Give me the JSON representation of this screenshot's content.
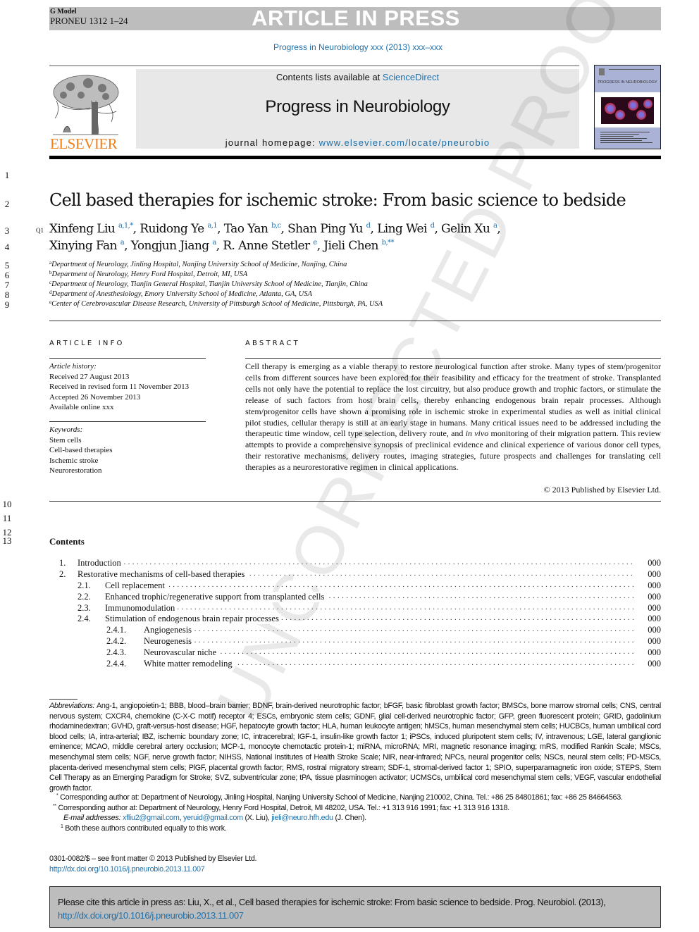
{
  "header": {
    "model": "G Model",
    "manuscript": "PRONEU 1312 1–24",
    "banner": "ARTICLE IN PRESS",
    "journal_ref": "Progress in Neurobiology xxx (2013) xxx–xxx"
  },
  "masthead": {
    "publisher": "ELSEVIER",
    "contents_prefix": "Contents lists available at ",
    "contents_link": "ScienceDirect",
    "journal_name": "Progress in Neurobiology",
    "homepage_prefix": "journal homepage: ",
    "homepage_link": "www.elsevier.com/locate/pneurobio",
    "cover_title": "PROGRESS IN NEUROBIOLOGY",
    "brand_color": "#f07f1b",
    "link_color": "#1f6fa8"
  },
  "line_numbers": [
    "1",
    "2",
    "3",
    "4",
    "5",
    "6",
    "7",
    "8",
    "9",
    "10",
    "11",
    "12",
    "13"
  ],
  "query_marker": "Q1",
  "article": {
    "title": "Cell based therapies for ischemic stroke: From basic science to bedside",
    "authors": [
      {
        "name": "Xinfeng Liu",
        "sup": "a,1,*",
        "sep": ", "
      },
      {
        "name": "Ruidong Ye",
        "sup": "a,1",
        "sep": ", "
      },
      {
        "name": "Tao Yan",
        "sup": "b,c",
        "sep": ", "
      },
      {
        "name": "Shan Ping Yu",
        "sup": "d",
        "sep": ", "
      },
      {
        "name": "Ling Wei",
        "sup": "d",
        "sep": ", "
      },
      {
        "name": "Gelin Xu",
        "sup": "a",
        "sep": ","
      },
      {
        "name": "Xinying Fan",
        "sup": "a",
        "sep": ", "
      },
      {
        "name": "Yongjun Jiang",
        "sup": "a",
        "sep": ", "
      },
      {
        "name": "R. Anne Stetler",
        "sup": "e",
        "sep": ", "
      },
      {
        "name": "Jieli Chen",
        "sup": "b,**",
        "sep": ""
      }
    ],
    "affiliations": [
      {
        "key": "a",
        "text": "Department of Neurology, Jinling Hospital, Nanjing University School of Medicine, Nanjing, China"
      },
      {
        "key": "b",
        "text": "Department of Neurology, Henry Ford Hospital, Detroit, MI, USA"
      },
      {
        "key": "c",
        "text": "Department of Neurology, Tianjin General Hospital, Tianjin University School of Medicine, Tianjin, China"
      },
      {
        "key": "d",
        "text": "Department of Anesthesiology, Emory University School of Medicine, Atlanta, GA, USA"
      },
      {
        "key": "e",
        "text": "Center of Cerebrovascular Disease Research, University of Pittsburgh School of Medicine, Pittsburgh, PA, USA"
      }
    ]
  },
  "article_info": {
    "heading": "ARTICLE INFO",
    "history_label": "Article history:",
    "history": [
      "Received 27 August 2013",
      "Received in revised form 11 November 2013",
      "Accepted 26 November 2013",
      "Available online xxx"
    ],
    "keywords_label": "Keywords:",
    "keywords": [
      "Stem cells",
      "Cell-based therapies",
      "Ischemic stroke",
      "Neurorestoration"
    ]
  },
  "abstract": {
    "heading": "ABSTRACT",
    "text_before_italic": "Cell therapy is emerging as a viable therapy to restore neurological function after stroke. Many types of stem/progenitor cells from different sources have been explored for their feasibility and efficacy for the treatment of stroke. Transplanted cells not only have the potential to replace the lost circuitry, but also produce growth and trophic factors, or stimulate the release of such factors from host brain cells, thereby enhancing endogenous brain repair processes. Although stem/progenitor cells have shown a promising role in ischemic stroke in experimental studies as well as initial clinical pilot studies, cellular therapy is still at an early stage in humans. Many critical issues need to be addressed including the therapeutic time window, cell type selection, delivery route, and ",
    "italic": "in vivo",
    "text_after_italic": " monitoring of their migration pattern. This review attempts to provide a comprehensive synopsis of preclinical evidence and clinical experience of various donor cell types, their restorative mechanisms, delivery routes, imaging strategies, future prospects and challenges for translating cell therapies as a neurorestorative regimen in clinical applications.",
    "copyright": "© 2013 Published by Elsevier Ltd."
  },
  "contents": {
    "heading": "Contents",
    "items": [
      {
        "num": "1.",
        "title": "Introduction",
        "page": "000",
        "level": 1
      },
      {
        "num": "2.",
        "title": "Restorative mechanisms of cell-based therapies",
        "page": "000",
        "level": 1
      },
      {
        "num": "2.1.",
        "title": "Cell replacement",
        "page": "000",
        "level": 2
      },
      {
        "num": "2.2.",
        "title": "Enhanced trophic/regenerative support from transplanted cells",
        "page": "000",
        "level": 2
      },
      {
        "num": "2.3.",
        "title": "Immunomodulation",
        "page": "000",
        "level": 2
      },
      {
        "num": "2.4.",
        "title": "Stimulation of endogenous brain repair processes",
        "page": "000",
        "level": 2
      },
      {
        "num": "2.4.1.",
        "title": "Angiogenesis",
        "page": "000",
        "level": 3
      },
      {
        "num": "2.4.2.",
        "title": "Neurogenesis",
        "page": "000",
        "level": 3
      },
      {
        "num": "2.4.3.",
        "title": "Neurovascular niche",
        "page": "000",
        "level": 3
      },
      {
        "num": "2.4.4.",
        "title": "White matter remodeling",
        "page": "000",
        "level": 3
      }
    ]
  },
  "watermark": "UNCORRECTED PROOF",
  "footnotes": {
    "abbreviations_label": "Abbreviations:",
    "abbreviations": " Ang-1, angiopoietin-1; BBB, blood–brain barrier; BDNF, brain-derived neurotrophic factor; bFGF, basic fibroblast growth factor; BMSCs, bone marrow stromal cells; CNS, central nervous system; CXCR4, chemokine (C-X-C motif) receptor 4; ESCs, embryonic stem cells; GDNF, glial cell-derived neurotrophic factor; GFP, green fluorescent protein; GRID, gadolinium rhodaminedextran; GVHD, graft-versus-host disease; HGF, hepatocyte growth factor; HLA, human leukocyte antigen; hMSCs, human mesenchymal stem cells; HUCBCs, human umbilical cord blood cells; IA, intra-arterial; IBZ, ischemic boundary zone; IC, intracerebral; IGF-1, insulin-like growth factor 1; iPSCs, induced pluripotent stem cells; IV, intravenous; LGE, lateral ganglionic eminence; MCAO, middle cerebral artery occlusion; MCP-1, monocyte chemotactic protein-1; miRNA, microRNA; MRI, magnetic resonance imaging; mRS, modified Rankin Scale; MSCs, mesenchymal stem cells; NGF, nerve growth factor; NIHSS, National Institutes of Health Stroke Scale; NIR, near-infrared; NPCs, neural progenitor cells; NSCs, neural stem cells; PD-MSCs, placenta-derived mesenchymal stem cells; PlGF, placental growth factor; RMS, rostral migratory stream; SDF-1, stromal-derived factor 1; SPIO, superparamagnetic iron oxide; STEPS, Stem Cell Therapy as an Emerging Paradigm for Stroke; SVZ, subventricular zone; tPA, tissue plasminogen activator; UCMSCs, umbilical cord mesenchymal stem cells; VEGF, vascular endothelial growth factor.",
    "corr1_mark": "*",
    "corr1": " Corresponding author at: Department of Neurology, Jinling Hospital, Nanjing University School of Medicine, Nanjing 210002, China. Tel.: +86 25 84801861; fax: +86 25 84664563.",
    "corr2_mark": "**",
    "corr2": " Corresponding author at: Department of Neurology, Henry Ford Hospital, Detroit, MI 48202, USA. Tel.: +1 313 916 1991; fax: +1 313 916 1318.",
    "email_label": "E-mail addresses:",
    "email1": "xfliu2@gmail.com",
    "email2": "yeruid@gmail.com",
    "email_owner1": " (X. Liu), ",
    "email3": "jieli@neuro.hfh.edu",
    "email_owner2": " (J. Chen).",
    "equal_mark": "1",
    "equal": " Both these authors contributed equally to this work.",
    "issn": "0301-0082/$ – see front matter © 2013 Published by Elsevier Ltd.",
    "doi": "http://dx.doi.org/10.1016/j.pneurobio.2013.11.007"
  },
  "cite_box": {
    "text": "Please cite this article in press as: Liu, X., et al., Cell based therapies for ischemic stroke: From basic science to bedside. Prog. Neurobiol. (2013), ",
    "doi": "http://dx.doi.org/10.1016/j.pneurobio.2013.11.007"
  }
}
